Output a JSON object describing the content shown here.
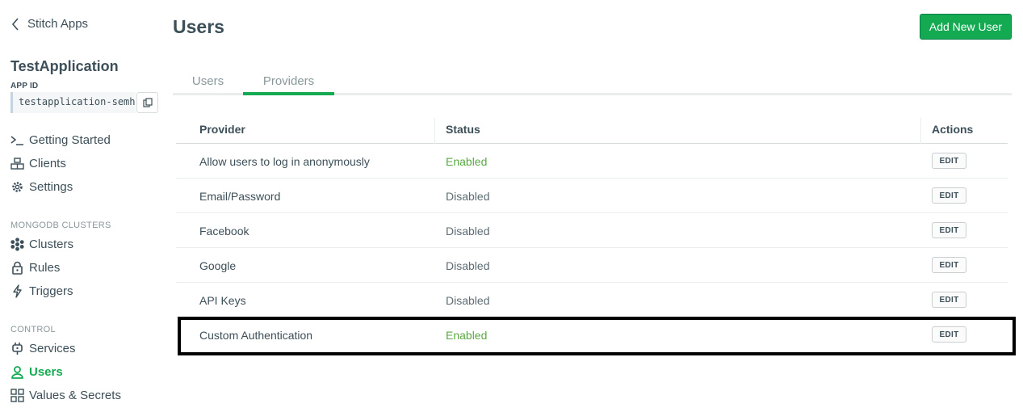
{
  "sidebar": {
    "back_label": "Stitch Apps",
    "app_name": "TestApplication",
    "app_id_label": "APP ID",
    "app_id_value": "testapplication-semho",
    "top_items": [
      {
        "label": "Getting Started",
        "icon": "terminal-icon"
      },
      {
        "label": "Clients",
        "icon": "clients-icon"
      },
      {
        "label": "Settings",
        "icon": "gear-icon"
      }
    ],
    "mongodb_section": "MONGODB CLUSTERS",
    "mongodb_items": [
      {
        "label": "Clusters",
        "icon": "cluster-icon"
      },
      {
        "label": "Rules",
        "icon": "lock-icon"
      },
      {
        "label": "Triggers",
        "icon": "bolt-icon"
      }
    ],
    "control_section": "CONTROL",
    "control_items": [
      {
        "label": "Services",
        "icon": "plug-icon"
      },
      {
        "label": "Users",
        "icon": "user-icon",
        "active": true
      },
      {
        "label": "Values & Secrets",
        "icon": "grid-icon"
      }
    ]
  },
  "header": {
    "title": "Users",
    "add_button": "Add New User"
  },
  "tabs": [
    {
      "label": "Users",
      "active": false
    },
    {
      "label": "Providers",
      "active": true
    }
  ],
  "table": {
    "columns": [
      "Provider",
      "Status",
      "Actions"
    ],
    "rows": [
      {
        "provider": "Allow users to log in anonymously",
        "status": "Enabled",
        "action": "EDIT"
      },
      {
        "provider": "Email/Password",
        "status": "Disabled",
        "action": "EDIT"
      },
      {
        "provider": "Facebook",
        "status": "Disabled",
        "action": "EDIT"
      },
      {
        "provider": "Google",
        "status": "Disabled",
        "action": "EDIT"
      },
      {
        "provider": "API Keys",
        "status": "Disabled",
        "action": "EDIT"
      },
      {
        "provider": "Custom Authentication",
        "status": "Enabled",
        "action": "EDIT"
      }
    ]
  },
  "colors": {
    "accent": "#13aa52",
    "enabled": "#5aa844",
    "text": "#3d4f58",
    "muted": "#89989b"
  }
}
